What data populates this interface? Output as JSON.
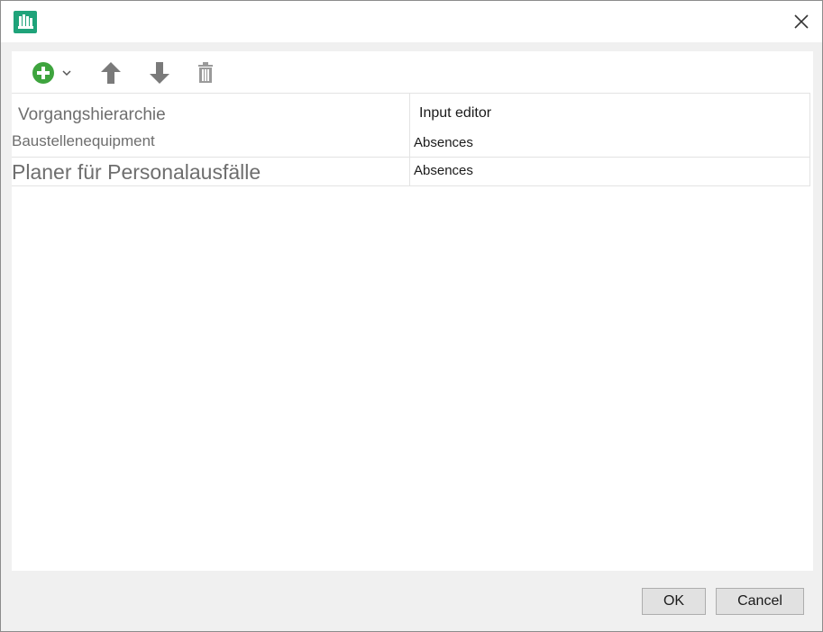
{
  "toolbar": {
    "add_icon": "plus-circle-icon",
    "dropdown_icon": "chevron-down-icon",
    "up_icon": "arrow-up-icon",
    "down_icon": "arrow-down-icon",
    "delete_icon": "trash-icon",
    "add_color": "#3ea43e"
  },
  "grid": {
    "columns": [
      "Vorgangshierarchie",
      "Input editor"
    ],
    "rows": [
      {
        "name": "Baustellenequipment",
        "editor": "Absences"
      },
      {
        "name": "Planer für Personalausfälle",
        "editor": "Absences"
      }
    ]
  },
  "footer": {
    "ok_label": "OK",
    "cancel_label": "Cancel"
  },
  "colors": {
    "brand": "#1fa37a",
    "border": "#e3e3e3"
  }
}
